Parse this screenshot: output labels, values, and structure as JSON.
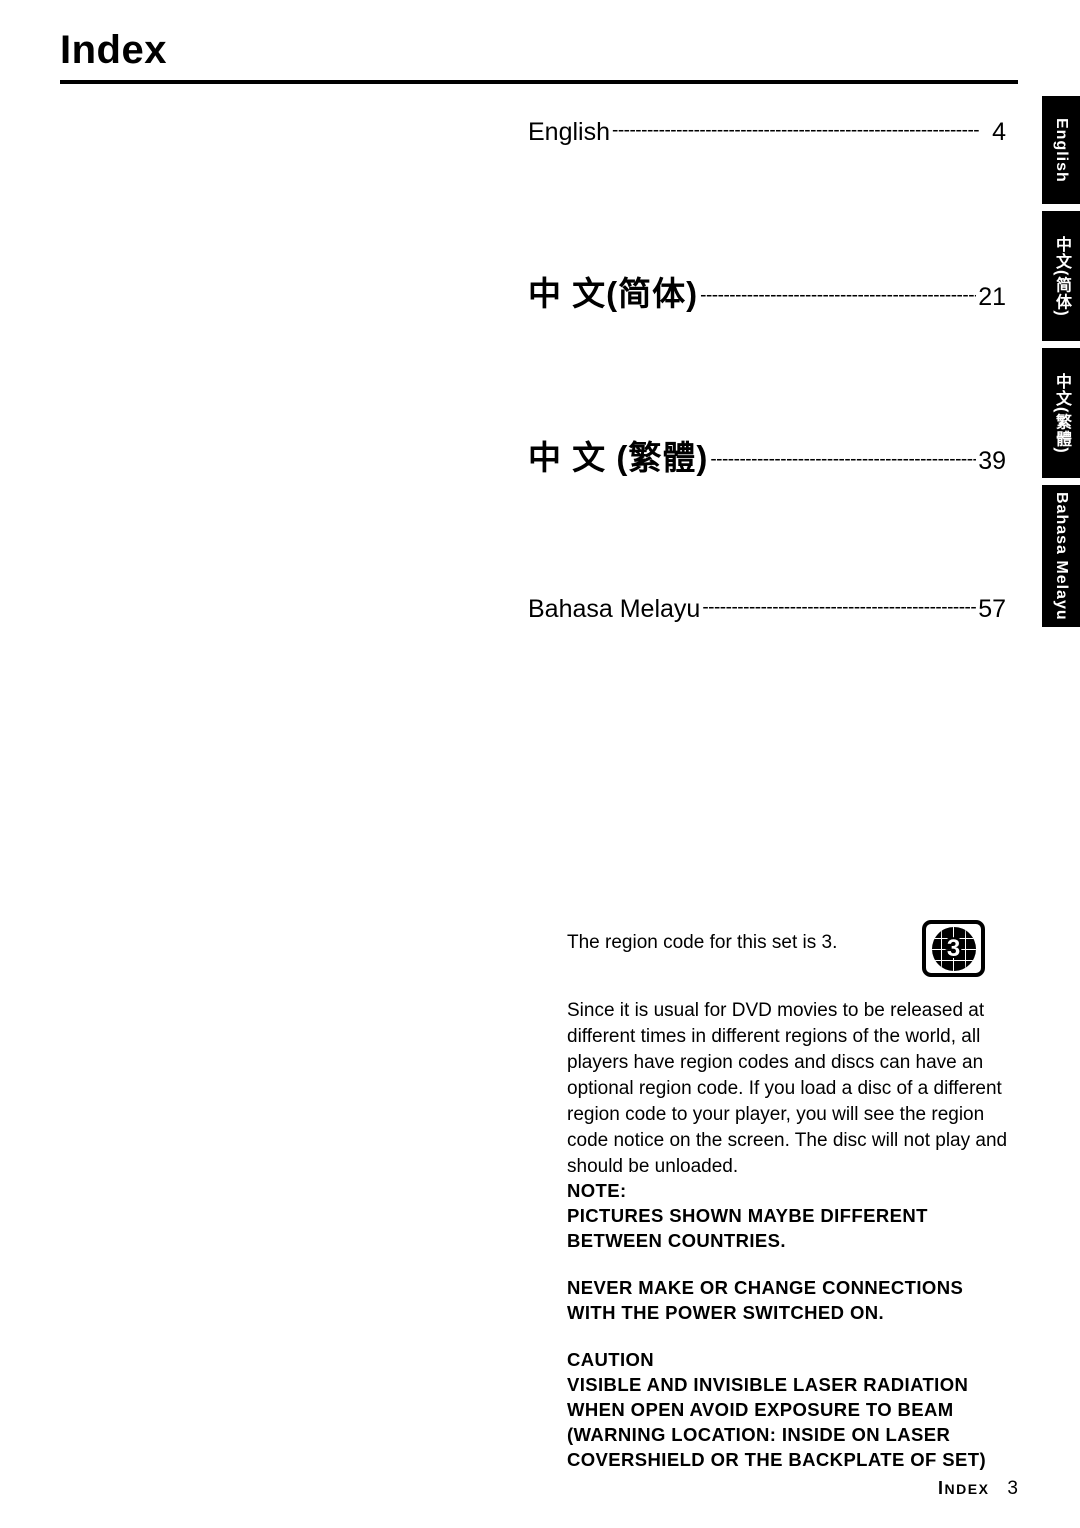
{
  "header": {
    "title": "Index"
  },
  "side_tabs": [
    {
      "label": "English"
    },
    {
      "label": "中文(简体)"
    },
    {
      "label": "中文(繁體)"
    },
    {
      "label": "Bahasa Melayu"
    }
  ],
  "toc": {
    "dots": "---------------------------------------------------------------",
    "entries": [
      {
        "language": "English",
        "page": "4"
      },
      {
        "language": "中 文(简体)",
        "page": "21"
      },
      {
        "language": "中 文 (繁體)",
        "page": "39"
      },
      {
        "language": "Bahasa Melayu",
        "page": "57"
      }
    ]
  },
  "region": {
    "line": "The region code for this set is 3.",
    "badge_number": "3"
  },
  "paragraph": "Since it is usual for DVD movies to be released at different times in different regions of the world, all players have region codes and discs can have an optional region code. If you load a disc of a different region code to your player, you will see the region code notice on the screen. The disc will not play and should be unloaded.",
  "notices": [
    {
      "lines": [
        "NOTE:",
        "PICTURES SHOWN MAYBE DIFFERENT",
        "BETWEEN COUNTRIES."
      ]
    },
    {
      "lines": [
        "NEVER MAKE OR CHANGE CONNECTIONS",
        "WITH THE POWER SWITCHED ON."
      ]
    },
    {
      "lines": [
        "CAUTION",
        "VISIBLE AND INVISIBLE LASER RADIATION",
        "WHEN OPEN AVOID EXPOSURE TO BEAM",
        "(WARNING LOCATION: INSIDE ON LASER",
        "COVERSHIELD OR THE BACKPLATE OF SET)"
      ]
    }
  ],
  "footer": {
    "label_first": "I",
    "label_rest": "NDEX",
    "page_number": "3"
  }
}
